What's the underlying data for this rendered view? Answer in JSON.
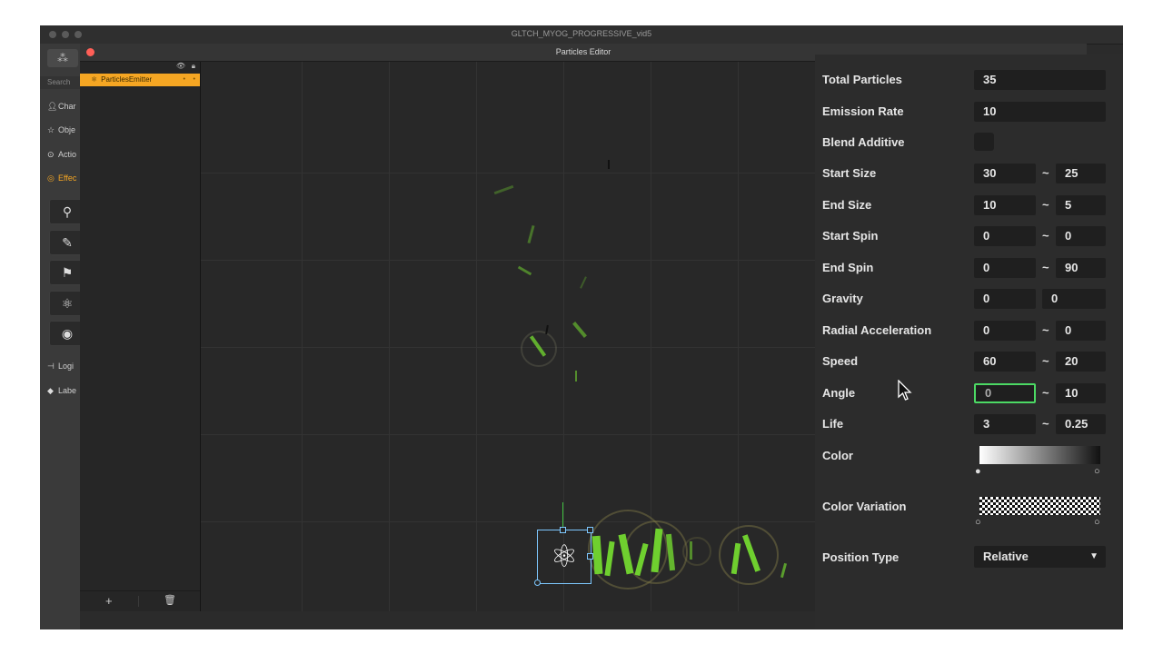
{
  "window": {
    "title": "GLTCH_MYOG_PROGRESSIVE_vid5"
  },
  "left_strip": {
    "search_label": "Search",
    "categories": [
      {
        "label": "Char",
        "icon": "person-icon",
        "active": false
      },
      {
        "label": "Obje",
        "icon": "star-icon",
        "active": false
      },
      {
        "label": "Actio",
        "icon": "play-circle-icon",
        "active": false
      },
      {
        "label": "Effec",
        "icon": "effects-icon",
        "active": true
      },
      {
        "label": "Logi",
        "icon": "logic-icon",
        "active": false
      },
      {
        "label": "Labe",
        "icon": "tag-icon",
        "active": false
      }
    ],
    "tools": [
      "light-bulb-icon",
      "brush-icon",
      "flag-icon",
      "atom-icon",
      "ring-icon"
    ]
  },
  "editor": {
    "title": "Particles Editor",
    "hierarchy": {
      "items": [
        {
          "label": "ParticlesEmitter",
          "selected": true
        }
      ]
    }
  },
  "properties": {
    "total_particles": {
      "label": "Total Particles",
      "value": "35"
    },
    "emission_rate": {
      "label": "Emission Rate",
      "value": "10"
    },
    "blend_additive": {
      "label": "Blend Additive",
      "checked": false
    },
    "start_size": {
      "label": "Start Size",
      "value": "30",
      "variance": "25"
    },
    "end_size": {
      "label": "End Size",
      "value": "10",
      "variance": "5"
    },
    "start_spin": {
      "label": "Start Spin",
      "value": "0",
      "variance": "0"
    },
    "end_spin": {
      "label": "End Spin",
      "value": "0",
      "variance": "90"
    },
    "gravity": {
      "label": "Gravity",
      "x": "0",
      "y": "0"
    },
    "radial_acceleration": {
      "label": "Radial Acceleration",
      "value": "0",
      "variance": "0"
    },
    "speed": {
      "label": "Speed",
      "value": "60",
      "variance": "20"
    },
    "angle": {
      "label": "Angle",
      "value": "0",
      "variance": "10"
    },
    "life": {
      "label": "Life",
      "value": "3",
      "variance": "0.25"
    },
    "color": {
      "label": "Color"
    },
    "color_variation": {
      "label": "Color Variation"
    },
    "position_type": {
      "label": "Position Type",
      "value": "Relative"
    },
    "tilde": "~"
  },
  "colors": {
    "accent": "#f5a623",
    "particle": "#6fcf2f",
    "focus": "#4cd964",
    "selection": "#7ec8ff"
  }
}
